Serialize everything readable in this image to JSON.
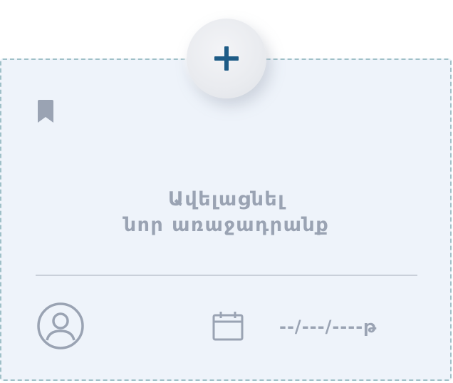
{
  "card": {
    "title_line1": "Ավելացնել",
    "title_line2": "նոր առաջադրանք",
    "date_placeholder": "--/---/----թ"
  },
  "icons": {
    "add": "plus-icon",
    "bookmark": "bookmark-icon",
    "avatar": "user-avatar-icon",
    "calendar": "calendar-icon"
  },
  "colors": {
    "card_bg": "#eef3fa",
    "dashed_border": "#9fc0c8",
    "plus": "#1d5b86",
    "muted_text": "#9aa3b3"
  }
}
